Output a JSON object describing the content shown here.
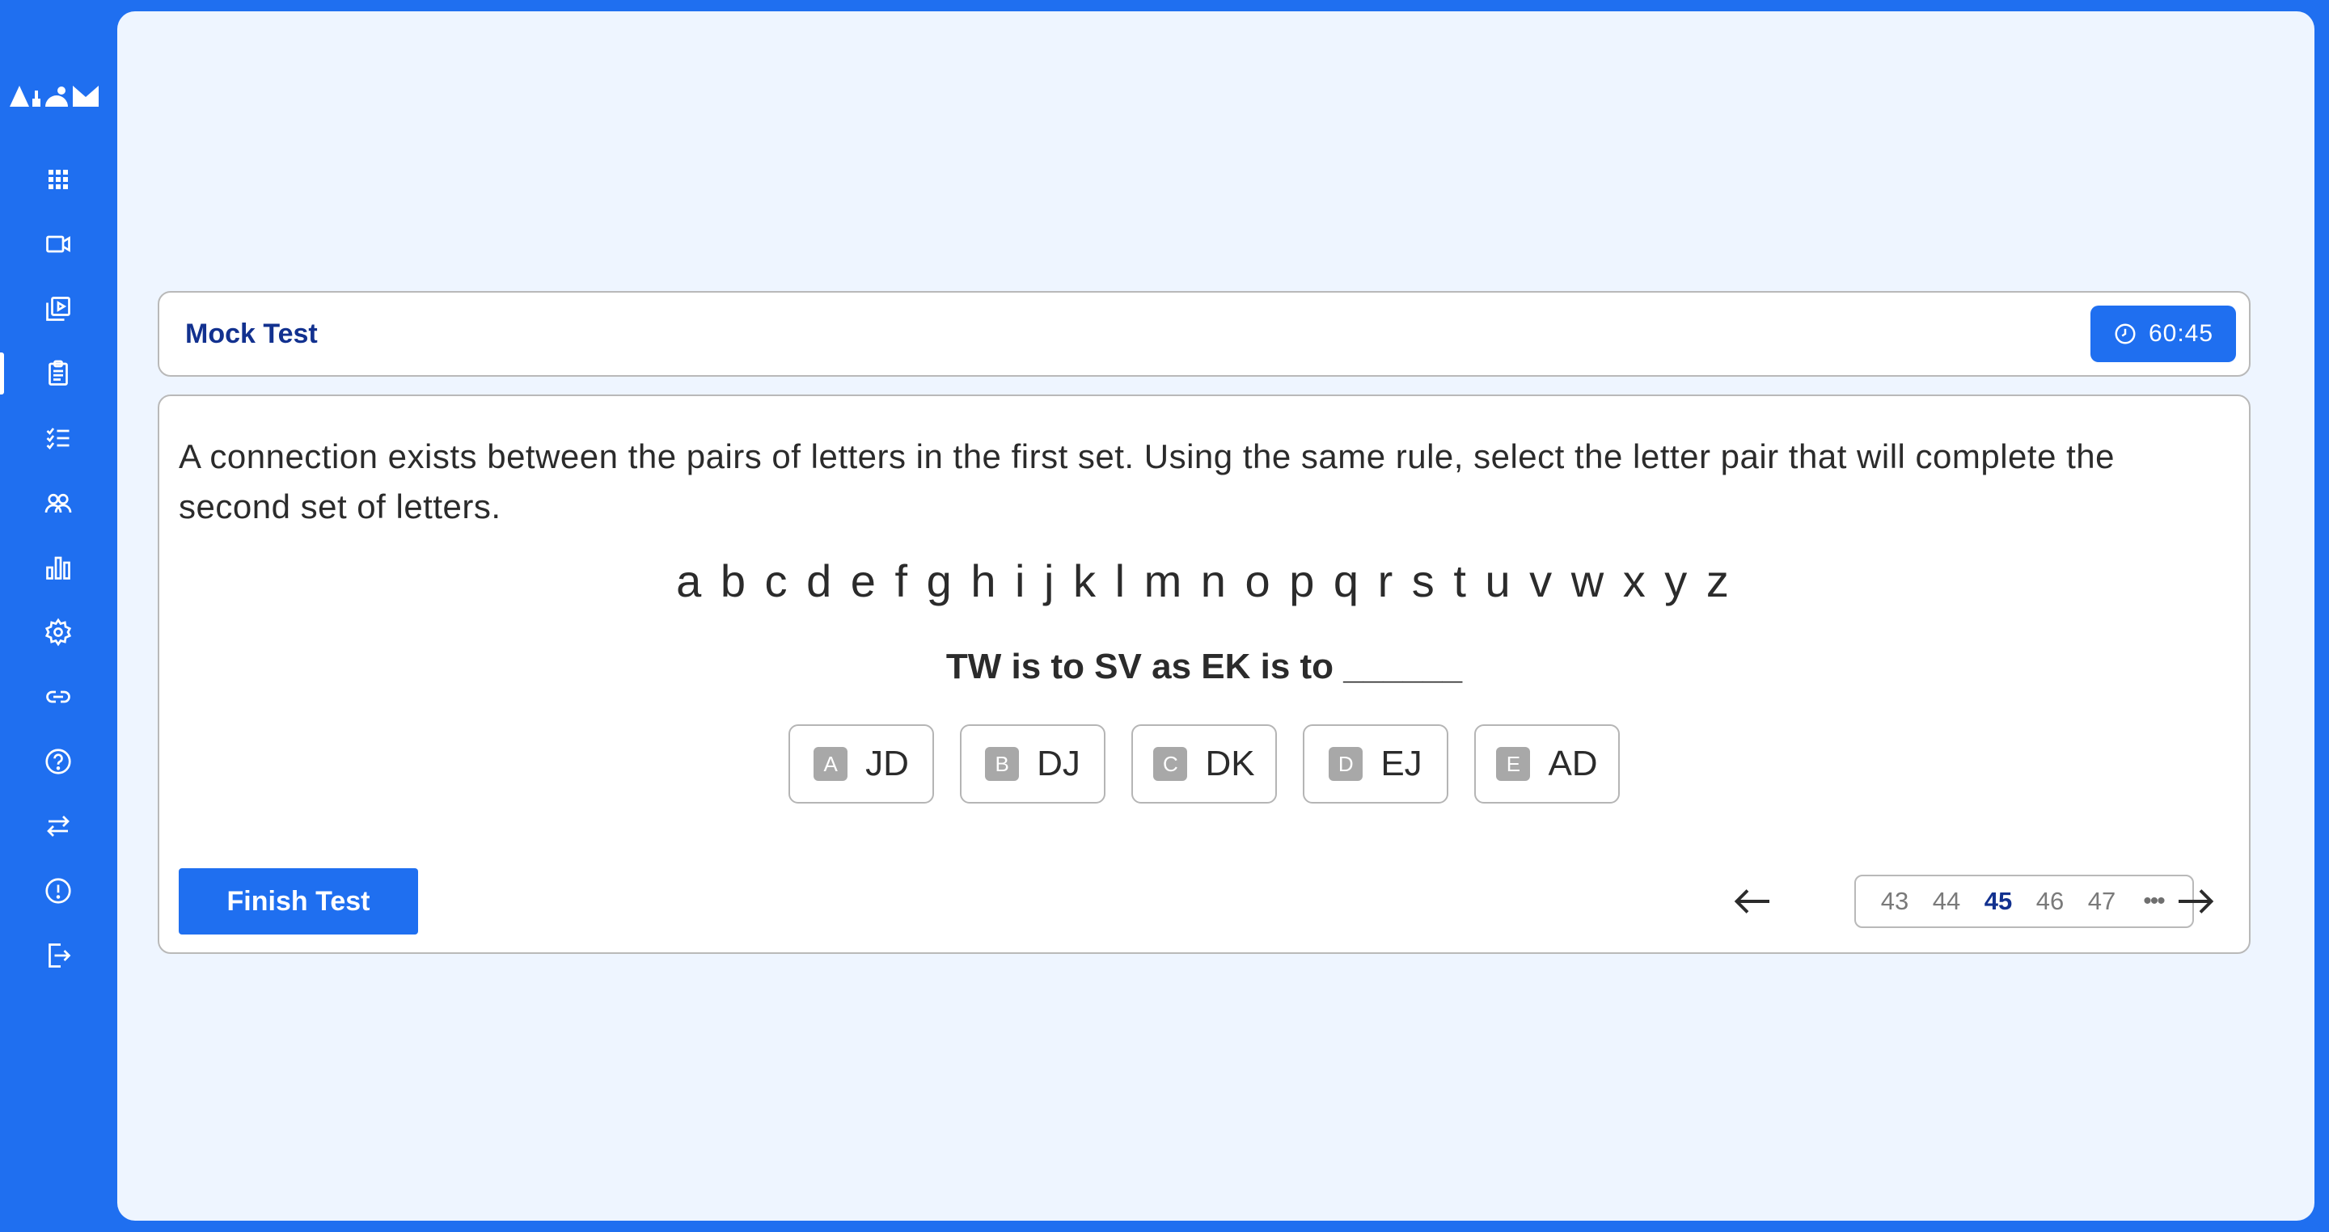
{
  "app": {
    "logo_text": "atom"
  },
  "sidebar": {
    "items": [
      {
        "icon": "grid-icon",
        "label": "Dashboard",
        "active": false
      },
      {
        "icon": "video-icon",
        "label": "Live Classes",
        "active": false
      },
      {
        "icon": "library-play-icon",
        "label": "Recorded Videos",
        "active": false
      },
      {
        "icon": "clipboard-icon",
        "label": "Tests",
        "active": true
      },
      {
        "icon": "checklist-icon",
        "label": "Tasks",
        "active": false
      },
      {
        "icon": "users-icon",
        "label": "Community",
        "active": false
      },
      {
        "icon": "bar-chart-icon",
        "label": "Analytics",
        "active": false
      },
      {
        "icon": "gear-icon",
        "label": "Settings",
        "active": false
      },
      {
        "icon": "link-icon",
        "label": "Links",
        "active": false
      },
      {
        "icon": "help-icon",
        "label": "Help",
        "active": false
      },
      {
        "icon": "swap-icon",
        "label": "Switch",
        "active": false
      },
      {
        "icon": "alert-icon",
        "label": "Report",
        "active": false
      },
      {
        "icon": "logout-icon",
        "label": "Logout",
        "active": false
      }
    ]
  },
  "header": {
    "title": "Mock Test",
    "timer": "60:45"
  },
  "question": {
    "text": "A connection exists between the pairs of letters in the first set. Using the same rule, select the letter pair that will complete the second set of letters.",
    "alphabet": "a b c d e f g h i j k l m n o p q r s t u v w x y z",
    "prompt": "TW is to SV as EK is to ______",
    "options": [
      {
        "letter": "A",
        "text": "JD"
      },
      {
        "letter": "B",
        "text": "DJ"
      },
      {
        "letter": "C",
        "text": "DK"
      },
      {
        "letter": "D",
        "text": "EJ"
      },
      {
        "letter": "E",
        "text": "AD"
      }
    ]
  },
  "footer": {
    "finish_label": "Finish Test",
    "pages": [
      "43",
      "44",
      "45",
      "46",
      "47"
    ],
    "current_page": "45",
    "more": "•••"
  }
}
